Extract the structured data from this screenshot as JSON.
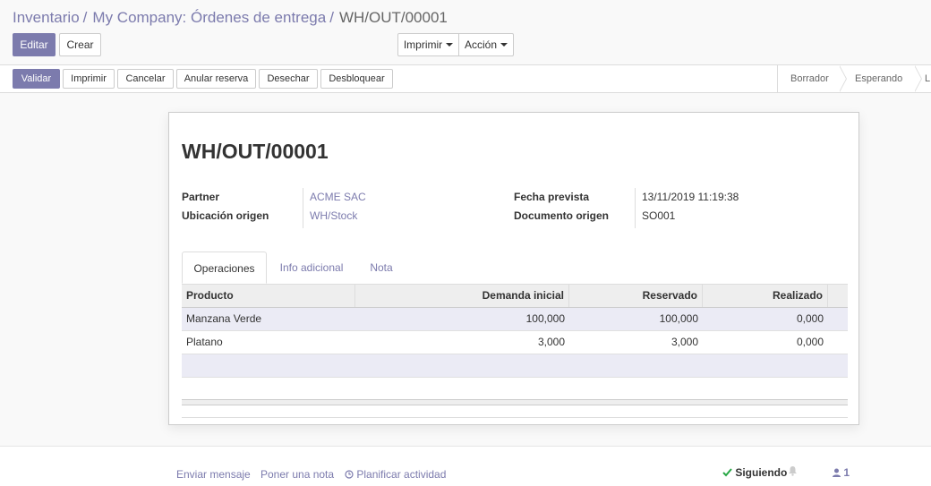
{
  "breadcrumb": {
    "items": [
      "Inventario",
      "My Company: Órdenes de entrega"
    ],
    "current": "WH/OUT/00001",
    "separator": "/"
  },
  "controlpanel": {
    "edit_label": "Editar",
    "create_label": "Crear",
    "print_label": "Imprimir",
    "action_label": "Acción"
  },
  "statusbar": {
    "buttons": [
      "Validar",
      "Imprimir",
      "Cancelar",
      "Anular reserva",
      "Desechar",
      "Desbloquear"
    ],
    "stages": [
      "Borrador",
      "Esperando",
      "L"
    ]
  },
  "record": {
    "name": "WH/OUT/00001",
    "fields_left": [
      {
        "label": "Partner",
        "value": "ACME SAC"
      },
      {
        "label": "Ubicación origen",
        "value": "WH/Stock"
      }
    ],
    "fields_right": [
      {
        "label": "Fecha prevista",
        "value": "13/11/2019 11:19:38"
      },
      {
        "label": "Documento origen",
        "value": "SO001"
      }
    ]
  },
  "tabs": [
    "Operaciones",
    "Info adicional",
    "Nota"
  ],
  "table": {
    "columns": [
      "Producto",
      "Demanda inicial",
      "Reservado",
      "Realizado"
    ],
    "rows": [
      [
        "Manzana Verde",
        "100,000",
        "100,000",
        "0,000"
      ],
      [
        "Platano",
        "3,000",
        "3,000",
        "0,000"
      ]
    ]
  },
  "chatter": {
    "send_message": "Enviar mensaje",
    "log_note": "Poner una nota",
    "schedule_activity": "Planificar actividad",
    "following": "Siguiendo",
    "followers_count": "1"
  },
  "colors": {
    "accent": "#7c7bad",
    "selected_row": "#ebebf5"
  }
}
